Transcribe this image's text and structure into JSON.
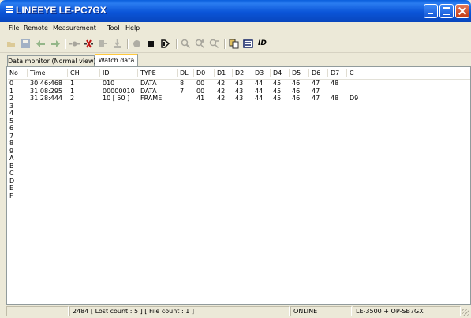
{
  "window": {
    "title": "LINEEYE LE-PC7GX"
  },
  "menu": [
    "File",
    "Remote",
    "Measurement",
    "Tool",
    "Help"
  ],
  "toolbar": {
    "id_label": "ID"
  },
  "tabs": [
    {
      "label": "Data monitor (Normal view)",
      "active": false
    },
    {
      "label": "Watch data",
      "active": true
    }
  ],
  "table": {
    "columns": [
      "No",
      "Time",
      "CH",
      "ID",
      "TYPE",
      "DL",
      "D0",
      "D1",
      "D2",
      "D3",
      "D4",
      "D5",
      "D6",
      "D7",
      "C"
    ],
    "rows": [
      [
        "0",
        "30:46:468",
        "1",
        "010",
        "DATA",
        "8",
        "00",
        "42",
        "43",
        "44",
        "45",
        "46",
        "47",
        "48",
        ""
      ],
      [
        "1",
        "31:08:295",
        "1",
        "00000010",
        "DATA",
        "7",
        "00",
        "42",
        "43",
        "44",
        "45",
        "46",
        "47",
        "",
        ""
      ],
      [
        "2",
        "31:28:444",
        "2",
        "10 [ 50 ]",
        "FRAME",
        "",
        "41",
        "42",
        "43",
        "44",
        "45",
        "46",
        "47",
        "48",
        "D9"
      ],
      [
        "3",
        "",
        "",
        "",
        "",
        "",
        "",
        "",
        "",
        "",
        "",
        "",
        "",
        "",
        ""
      ],
      [
        "4",
        "",
        "",
        "",
        "",
        "",
        "",
        "",
        "",
        "",
        "",
        "",
        "",
        "",
        ""
      ],
      [
        "5",
        "",
        "",
        "",
        "",
        "",
        "",
        "",
        "",
        "",
        "",
        "",
        "",
        "",
        ""
      ],
      [
        "6",
        "",
        "",
        "",
        "",
        "",
        "",
        "",
        "",
        "",
        "",
        "",
        "",
        "",
        ""
      ],
      [
        "7",
        "",
        "",
        "",
        "",
        "",
        "",
        "",
        "",
        "",
        "",
        "",
        "",
        "",
        ""
      ],
      [
        "8",
        "",
        "",
        "",
        "",
        "",
        "",
        "",
        "",
        "",
        "",
        "",
        "",
        "",
        ""
      ],
      [
        "9",
        "",
        "",
        "",
        "",
        "",
        "",
        "",
        "",
        "",
        "",
        "",
        "",
        "",
        ""
      ],
      [
        "A",
        "",
        "",
        "",
        "",
        "",
        "",
        "",
        "",
        "",
        "",
        "",
        "",
        "",
        ""
      ],
      [
        "B",
        "",
        "",
        "",
        "",
        "",
        "",
        "",
        "",
        "",
        "",
        "",
        "",
        "",
        ""
      ],
      [
        "C",
        "",
        "",
        "",
        "",
        "",
        "",
        "",
        "",
        "",
        "",
        "",
        "",
        "",
        ""
      ],
      [
        "D",
        "",
        "",
        "",
        "",
        "",
        "",
        "",
        "",
        "",
        "",
        "",
        "",
        "",
        ""
      ],
      [
        "E",
        "",
        "",
        "",
        "",
        "",
        "",
        "",
        "",
        "",
        "",
        "",
        "",
        "",
        ""
      ],
      [
        "F",
        "",
        "",
        "",
        "",
        "",
        "",
        "",
        "",
        "",
        "",
        "",
        "",
        "",
        ""
      ]
    ]
  },
  "status": {
    "count": "2484 [ Lost count : 5 ] [ File count : 1 ]",
    "connection": "ONLINE",
    "device": "LE-3500 + OP-SB7GX"
  },
  "colors": {
    "titlebar": "#0a5fdc",
    "close": "#c33b14",
    "tab_highlight": "#ffc83c",
    "record": "#b01010"
  }
}
